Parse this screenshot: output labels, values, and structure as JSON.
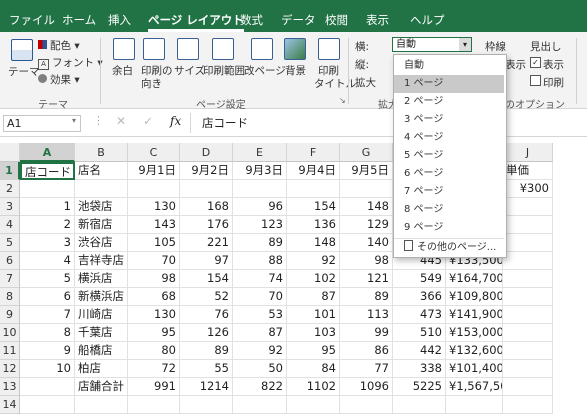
{
  "tabs": [
    "ファイル",
    "ホーム",
    "挿入",
    "ページ レイアウト",
    "数式",
    "データ",
    "校閲",
    "表示",
    "ヘルプ"
  ],
  "active_tab": "ページ レイアウト",
  "ribbon": {
    "theme": {
      "theme_label": "テーマ",
      "colors": "配色",
      "fonts": "フォント",
      "effects": "効果",
      "group": "テーマ"
    },
    "page_setup": {
      "margins": "余白",
      "orientation_1": "印刷の",
      "orientation_2": "向き",
      "size": "サイズ",
      "print_area": "印刷範囲",
      "breaks": "改ページ",
      "background": "背景",
      "titles_1": "印刷",
      "titles_2": "タイトル",
      "group": "ページ設定"
    },
    "scale": {
      "width_label": "横:",
      "width_value": "自動",
      "height_label": "縦:",
      "scale_label": "拡大",
      "group": "拡大"
    },
    "sheet_options": {
      "gridlines": "枠線",
      "headings": "見出し",
      "view1": "表示",
      "view2": "表示",
      "print2": "印刷",
      "group": "のオプション"
    }
  },
  "formula_bar": {
    "name_box": "A1",
    "fx": "fx",
    "content": "店コード"
  },
  "columns": [
    "A",
    "B",
    "C",
    "D",
    "E",
    "F",
    "G",
    "H",
    "I",
    "J"
  ],
  "rows": [
    [
      "店コード",
      "店名",
      "9月1日",
      "9月2日",
      "9月3日",
      "9月4日",
      "9月5日",
      "",
      "",
      "単価"
    ],
    [
      "",
      "",
      "",
      "",
      "",
      "",
      "",
      "",
      "",
      "¥300"
    ],
    [
      "1",
      "池袋店",
      "130",
      "168",
      "96",
      "154",
      "148",
      "",
      "¥...00",
      ""
    ],
    [
      "2",
      "新宿店",
      "143",
      "176",
      "123",
      "136",
      "129",
      "",
      "¥...00",
      ""
    ],
    [
      "3",
      "渋谷店",
      "105",
      "221",
      "89",
      "148",
      "140",
      "",
      "¥...00",
      ""
    ],
    [
      "4",
      "吉祥寺店",
      "70",
      "97",
      "88",
      "92",
      "98",
      "445",
      "¥133,500",
      ""
    ],
    [
      "5",
      "横浜店",
      "98",
      "154",
      "74",
      "102",
      "121",
      "549",
      "¥164,700",
      ""
    ],
    [
      "6",
      "新横浜店",
      "68",
      "52",
      "70",
      "87",
      "89",
      "366",
      "¥109,800",
      ""
    ],
    [
      "7",
      "川崎店",
      "130",
      "76",
      "53",
      "101",
      "113",
      "473",
      "¥141,900",
      ""
    ],
    [
      "8",
      "千葉店",
      "95",
      "126",
      "87",
      "103",
      "99",
      "510",
      "¥153,000",
      ""
    ],
    [
      "9",
      "船橋店",
      "80",
      "89",
      "92",
      "95",
      "86",
      "442",
      "¥132,600",
      ""
    ],
    [
      "10",
      "柏店",
      "72",
      "55",
      "50",
      "84",
      "77",
      "338",
      "¥101,400",
      ""
    ],
    [
      "",
      "店舗合計",
      "991",
      "1214",
      "822",
      "1102",
      "1096",
      "5225",
      "¥1,567,500",
      ""
    ],
    [
      "",
      "",
      "",
      "",
      "",
      "",
      "",
      "",
      "",
      ""
    ]
  ],
  "dropdown": {
    "items": [
      "自動",
      "1 ページ",
      "2 ページ",
      "3 ページ",
      "4 ページ",
      "5 ページ",
      "6 ページ",
      "7 ページ",
      "8 ページ",
      "9 ページ"
    ],
    "highlighted": "1 ページ",
    "more": "その他のページ..."
  }
}
